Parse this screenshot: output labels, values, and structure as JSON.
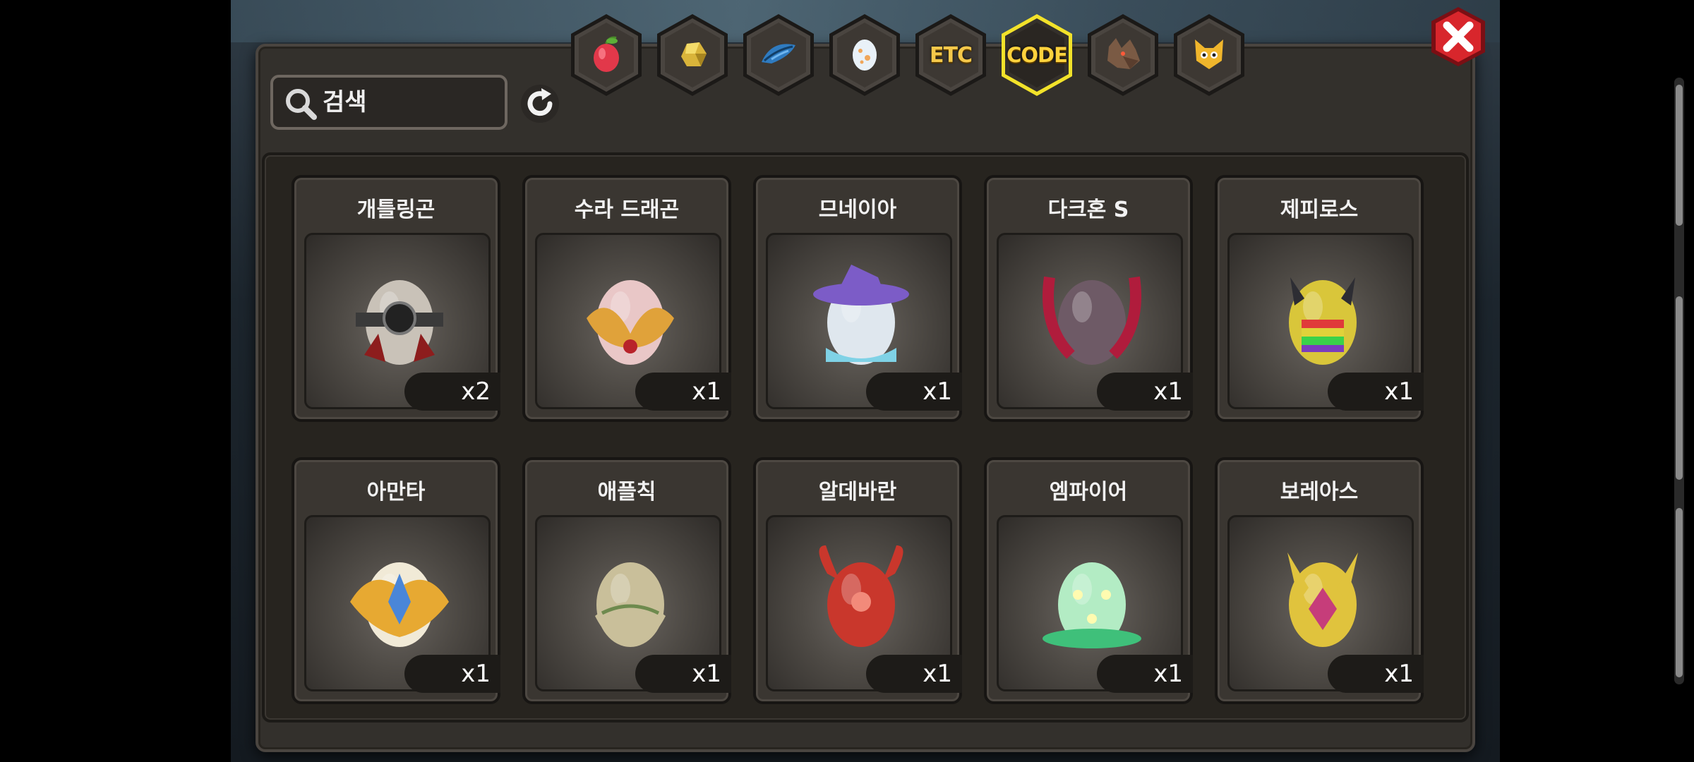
{
  "search": {
    "placeholder": "검색"
  },
  "tabs": [
    {
      "id": "fruit",
      "icon": "fruit-icon",
      "label": ""
    },
    {
      "id": "ore",
      "icon": "gold-ore-icon",
      "label": ""
    },
    {
      "id": "feather",
      "icon": "blue-feather-icon",
      "label": ""
    },
    {
      "id": "egg",
      "icon": "egg-icon",
      "label": ""
    },
    {
      "id": "etc",
      "icon": "",
      "label": "ETC"
    },
    {
      "id": "code",
      "icon": "",
      "label": "CODE",
      "selected": true
    },
    {
      "id": "beast",
      "icon": "wolf-head-icon",
      "label": ""
    },
    {
      "id": "pet",
      "icon": "yellow-cat-icon",
      "label": ""
    }
  ],
  "eggs": [
    {
      "name": "개틀링곤",
      "qty": "x2",
      "icon": "gatling-egg-icon",
      "colors": [
        "#8d1d1d",
        "#c9c2b8",
        "#3a3a3a"
      ]
    },
    {
      "name": "수라 드래곤",
      "qty": "x1",
      "icon": "sura-dragon-egg-icon",
      "colors": [
        "#e0a23a",
        "#e9c7c7",
        "#b8232a"
      ]
    },
    {
      "name": "므네이아",
      "qty": "x1",
      "icon": "mneia-egg-icon",
      "colors": [
        "#7c5cc7",
        "#dfe7ee",
        "#7fd2e6"
      ]
    },
    {
      "name": "다크혼 S",
      "qty": "x1",
      "icon": "darkhorn-egg-icon",
      "colors": [
        "#b01c3c",
        "#6e5a66",
        "#2a1f24"
      ]
    },
    {
      "name": "제피로스",
      "qty": "x1",
      "icon": "zephyros-egg-icon",
      "colors": [
        "#2d2d33",
        "#d9c63a",
        "#7a3dbd"
      ]
    },
    {
      "name": "아만타",
      "qty": "x1",
      "icon": "amanta-egg-icon",
      "colors": [
        "#e7a932",
        "#f1ead7",
        "#4a86d8"
      ]
    },
    {
      "name": "애플칙",
      "qty": "x1",
      "icon": "applechick-egg-icon",
      "colors": [
        "#e9dfc0",
        "#c9bf9a",
        "#6e8a4e"
      ]
    },
    {
      "name": "알데바란",
      "qty": "x1",
      "icon": "aldebaran-egg-icon",
      "colors": [
        "#7a2b22",
        "#c9372c",
        "#a33a3a"
      ]
    },
    {
      "name": "엠파이어",
      "qty": "x1",
      "icon": "empire-egg-icon",
      "colors": [
        "#3fc07a",
        "#b3ecc4",
        "#1e6e48"
      ]
    },
    {
      "name": "보레아스",
      "qty": "x1",
      "icon": "boreas-egg-icon",
      "colors": [
        "#b6e6ef",
        "#e0c33d",
        "#c63d7a"
      ]
    }
  ]
}
